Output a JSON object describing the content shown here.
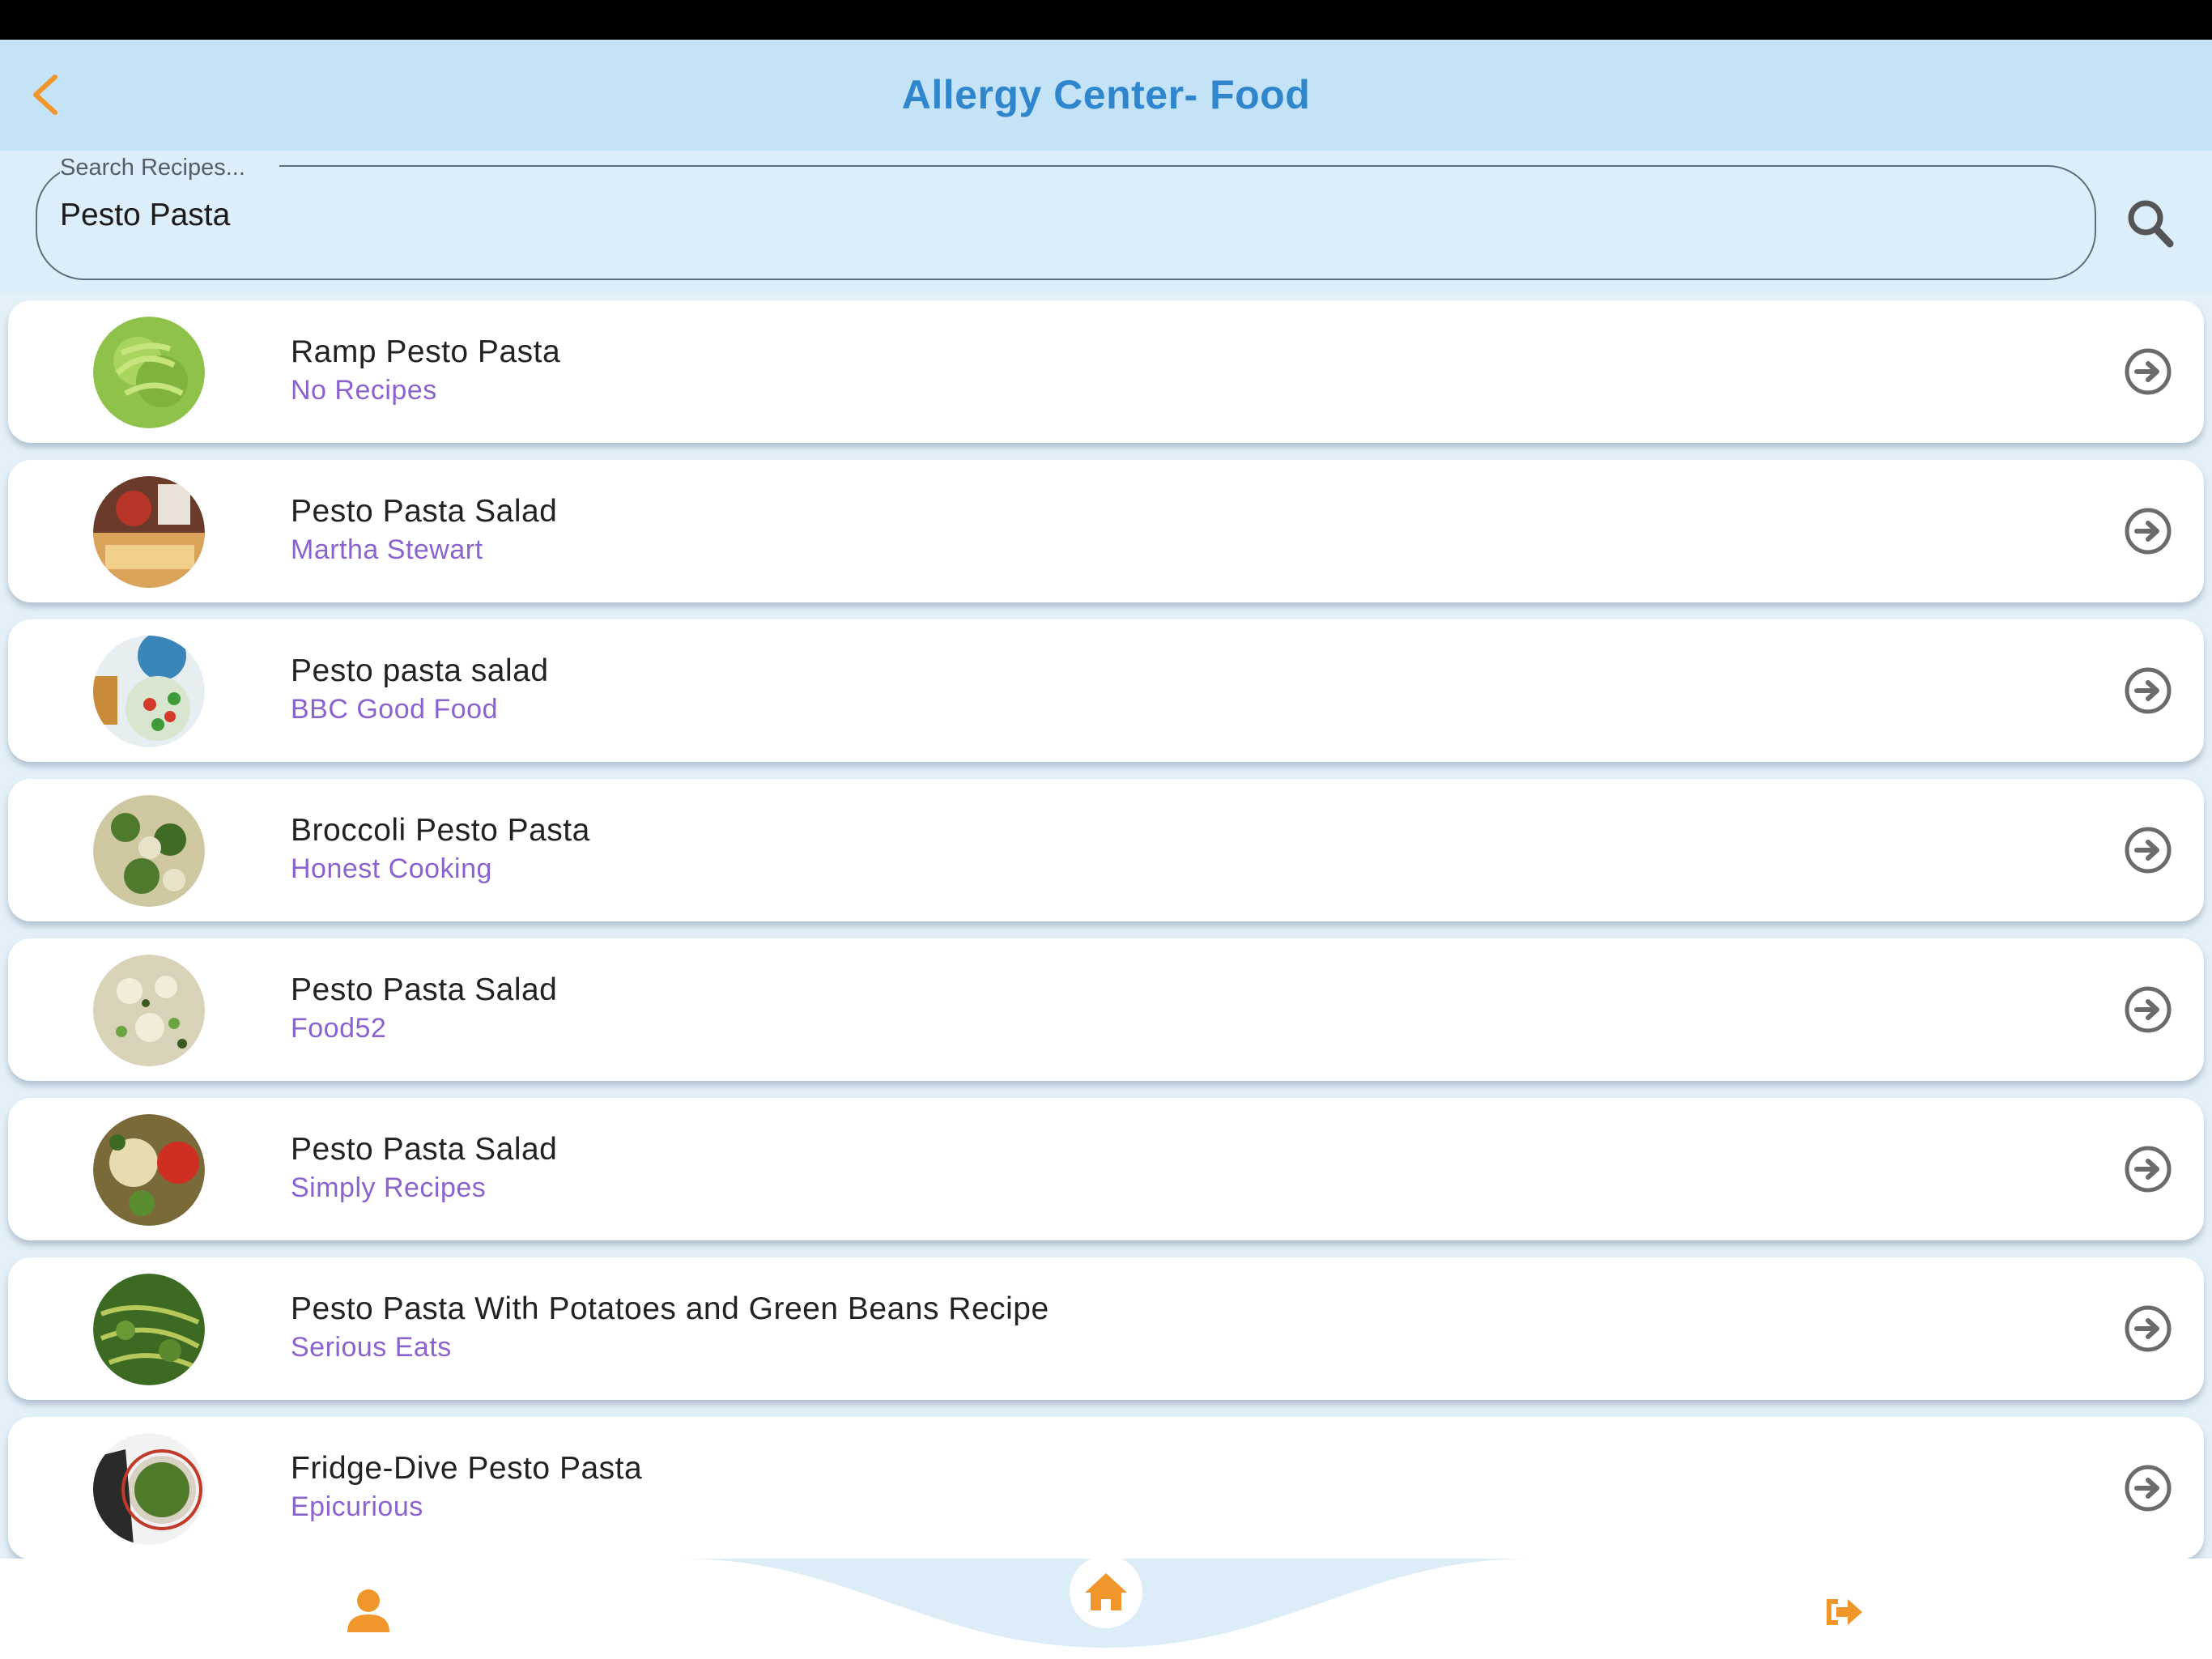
{
  "header": {
    "title": "Allergy Center- Food",
    "back_icon": "chevron-left-icon"
  },
  "search": {
    "label": "Search Recipes...",
    "value": "Pesto Pasta",
    "icon": "search-icon"
  },
  "recipes": [
    {
      "title": "Ramp Pesto Pasta",
      "source": "No Recipes"
    },
    {
      "title": "Pesto Pasta Salad",
      "source": "Martha Stewart"
    },
    {
      "title": "Pesto pasta salad",
      "source": "BBC Good Food"
    },
    {
      "title": "Broccoli Pesto Pasta",
      "source": "Honest Cooking"
    },
    {
      "title": "Pesto Pasta Salad",
      "source": "Food52"
    },
    {
      "title": "Pesto Pasta Salad",
      "source": "Simply Recipes"
    },
    {
      "title": "Pesto Pasta With Potatoes and Green Beans Recipe",
      "source": "Serious Eats"
    },
    {
      "title": "Fridge-Dive Pesto Pasta",
      "source": "Epicurious"
    }
  ],
  "bottom_nav": {
    "items": [
      "user-icon",
      "home-icon",
      "sign-out-icon"
    ]
  },
  "colors": {
    "header_bg": "#c5e3f6",
    "title": "#2f86cc",
    "accent_orange": "#f0962a",
    "source_text": "#8a63cf",
    "arrow_gray": "#6b6b6b"
  }
}
